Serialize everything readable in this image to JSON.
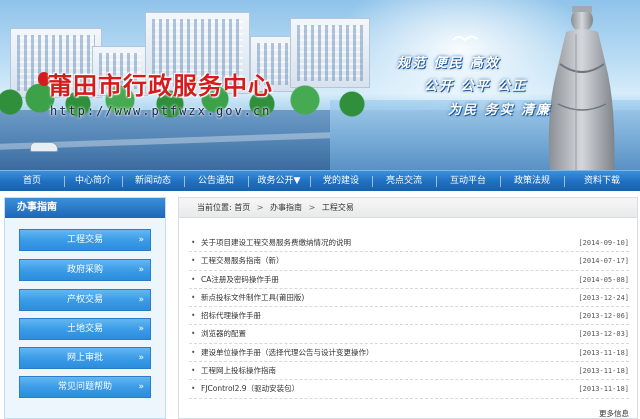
{
  "banner": {
    "title": "莆田市行政服务中心",
    "url": "http://www.ptfwzx.gov.cn",
    "slogans": [
      "规范 便民 高效",
      "公开 公平 公正",
      "为民 务实 清廉"
    ]
  },
  "nav": {
    "items": [
      {
        "label": "首页"
      },
      {
        "label": "中心简介"
      },
      {
        "label": "新闻动态"
      },
      {
        "label": "公告通知"
      },
      {
        "label": "政务公开▼"
      },
      {
        "label": "党的建设"
      },
      {
        "label": "亮点交流"
      },
      {
        "label": "互动平台"
      },
      {
        "label": "政策法规"
      },
      {
        "label": "资料下载"
      }
    ]
  },
  "sidebar": {
    "heading": "办事指南",
    "items": [
      {
        "label": "工程交易"
      },
      {
        "label": "政府采购"
      },
      {
        "label": "产权交易"
      },
      {
        "label": "土地交易"
      },
      {
        "label": "网上审批"
      },
      {
        "label": "常见问题帮助"
      }
    ],
    "arrow": "»"
  },
  "breadcrumb": {
    "prefix": "当前位置:",
    "items": [
      "首页",
      "办事指南",
      "工程交易"
    ],
    "separator": ">"
  },
  "news": {
    "bullet": "•",
    "items": [
      {
        "title": "关于项目建设工程交易服务费缴纳情况的说明",
        "date": "[2014-09-10]"
      },
      {
        "title": "工程交易服务指南（新）",
        "date": "[2014-07-17]"
      },
      {
        "title": "CA注册及密码操作手册",
        "date": "[2014-05-08]"
      },
      {
        "title": "新点投标文件制作工具(莆田版)",
        "date": "[2013-12-24]"
      },
      {
        "title": "招标代理操作手册",
        "date": "[2013-12-06]"
      },
      {
        "title": "浏览器的配置",
        "date": "[2013-12-03]"
      },
      {
        "title": "建设单位操作手册（选择代理公告与设计变更操作）",
        "date": "[2013-11-18]"
      },
      {
        "title": "工程网上投标操作指南",
        "date": "[2013-11-18]"
      },
      {
        "title": "FJControl2.9（驱动安装包）",
        "date": "[2013-11-18]"
      }
    ],
    "more": "更多信息"
  }
}
